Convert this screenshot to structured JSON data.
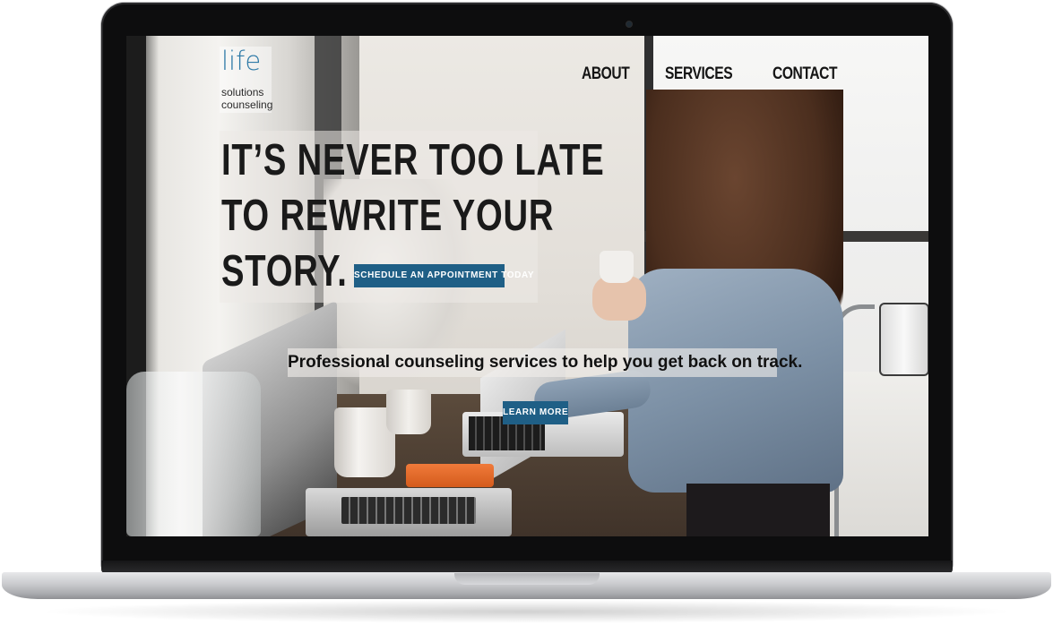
{
  "brand": {
    "logo_word": "life",
    "logo_line2": "solutions",
    "logo_line3": "counseling",
    "accent_color": "#2e7aa7"
  },
  "nav": {
    "items": [
      {
        "label": "ABOUT"
      },
      {
        "label": "SERVICES"
      },
      {
        "label": "CONTACT"
      }
    ]
  },
  "hero": {
    "headline_lines": [
      "IT’S NEVER TOO LATE",
      "TO REWRITE YOUR",
      "STORY."
    ],
    "cta_label": "SCHEDULE AN APPOINTMENT TODAY",
    "button_color": "#1f5f86"
  },
  "tagline": {
    "text": "Professional counseling services to help you get back on track.",
    "cta_label": "LEARN MORE"
  }
}
